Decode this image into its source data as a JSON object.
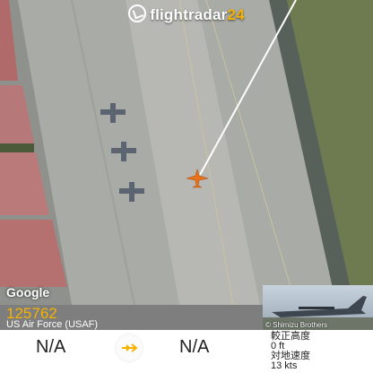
{
  "logo": {
    "brand": "flightradar",
    "suffix": "24",
    "icon": "radar-icon"
  },
  "map": {
    "attribution": "Google"
  },
  "flight": {
    "registration": "125762",
    "operator": "US Air Force (USAF)",
    "origin": "N/A",
    "destination": "N/A",
    "photo_credit": "© Shimizu Brothers",
    "altitude_label": "較正高度",
    "altitude_value": "0 ft",
    "speed_label": "対地速度",
    "speed_value": "13 kts"
  },
  "colors": {
    "accent": "#f5b300",
    "aircraft": "#e8731c"
  }
}
